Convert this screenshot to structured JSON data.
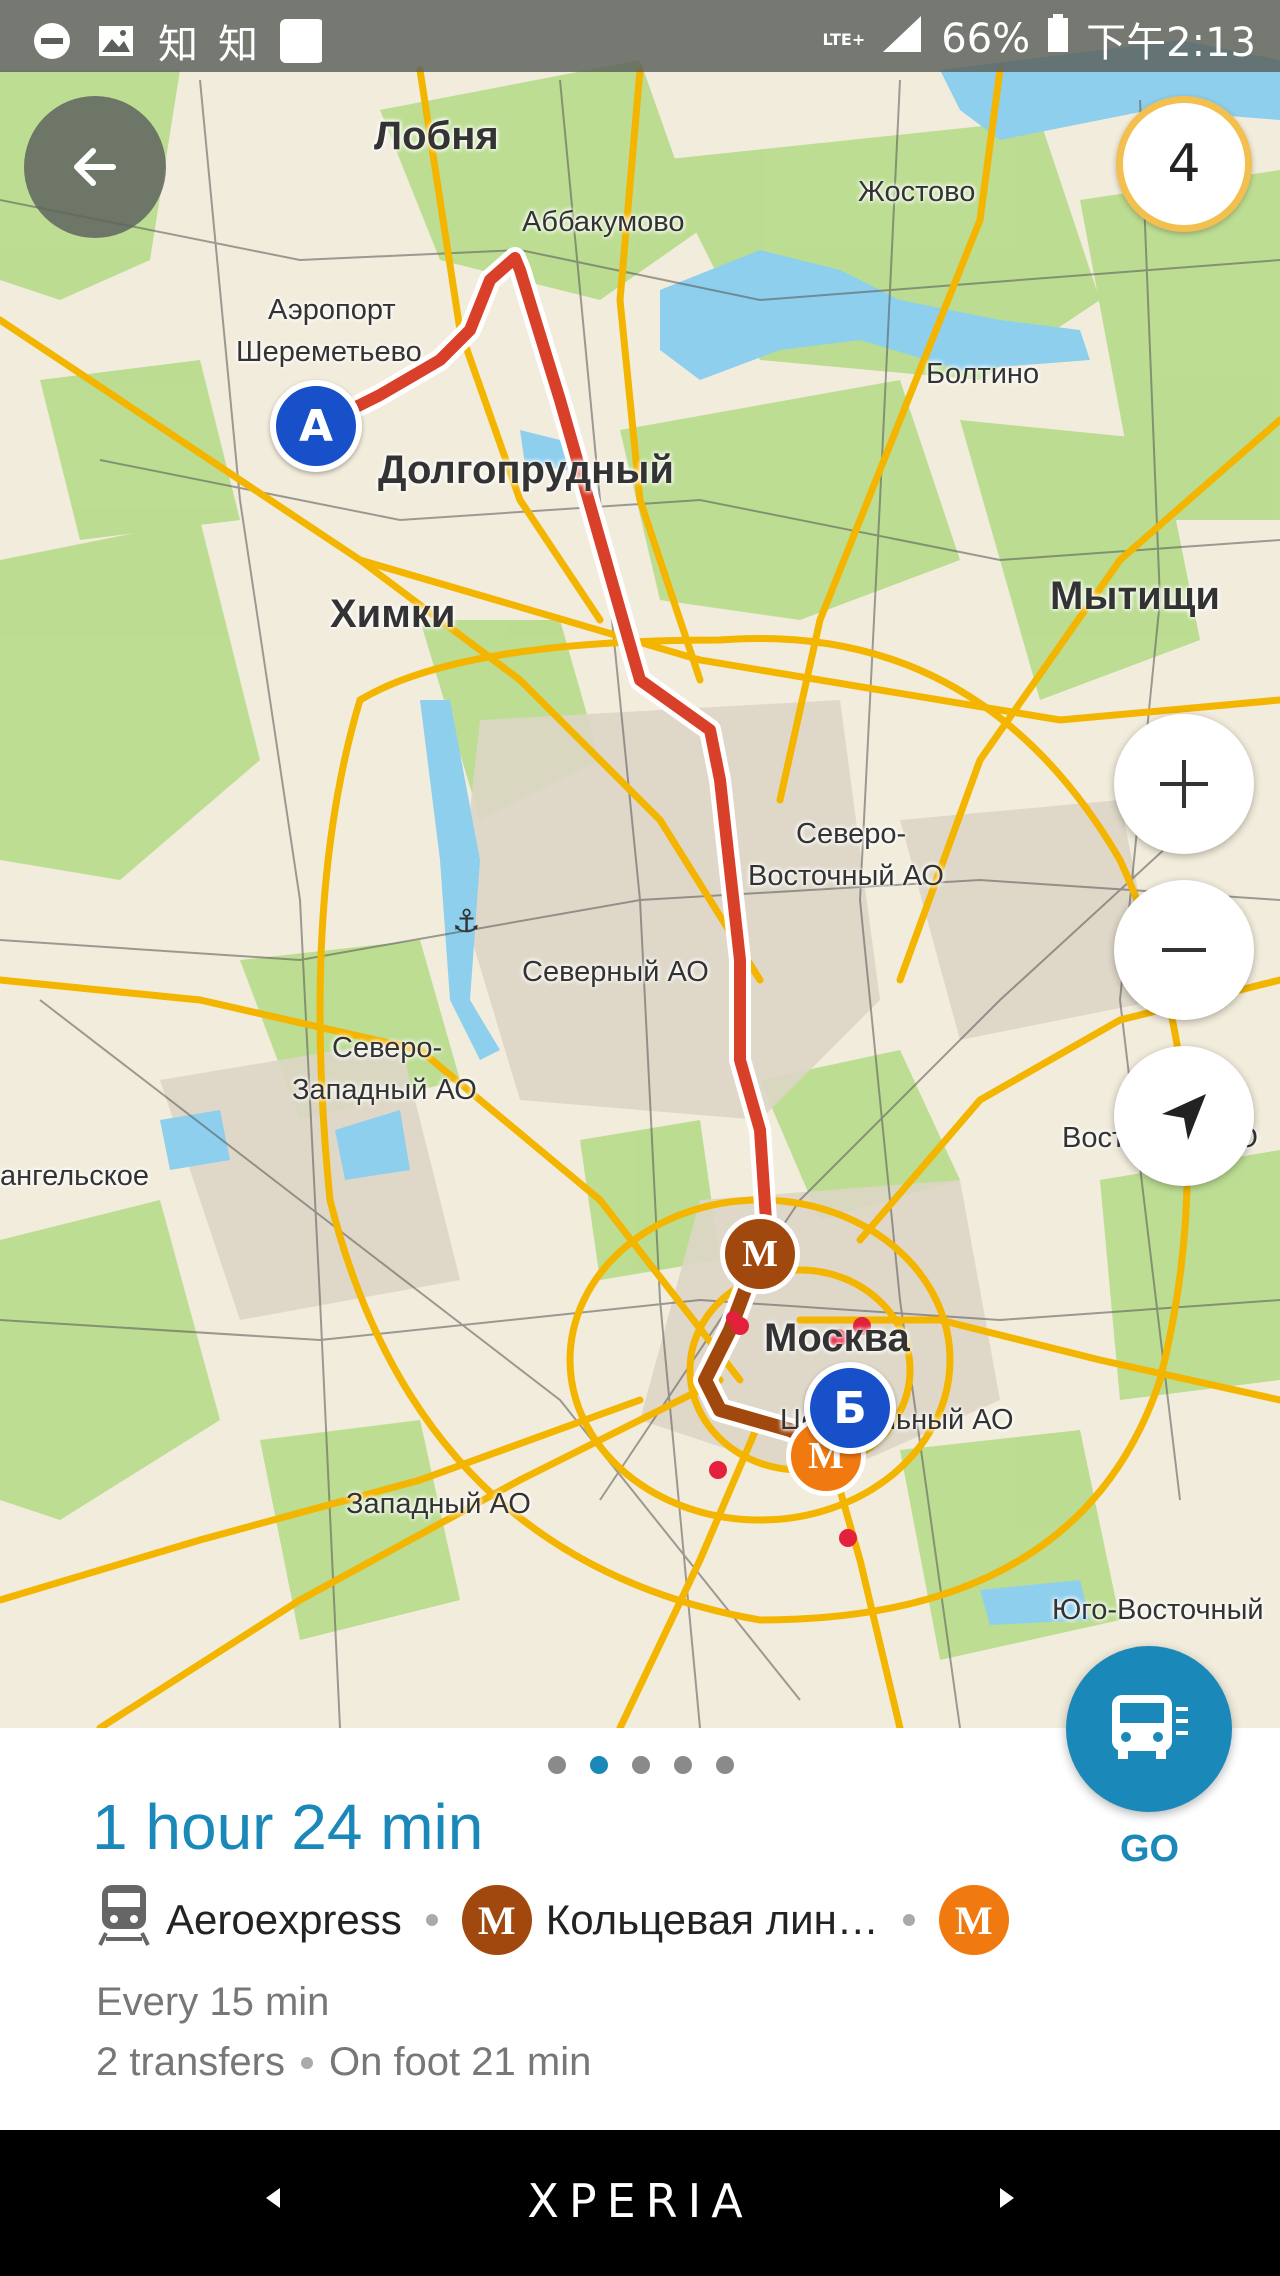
{
  "status_bar": {
    "left_icons": [
      "minus-circle-icon",
      "image-icon"
    ],
    "app_text_1": "知",
    "app_text_2": "知",
    "network": "LTE+",
    "battery": "66%",
    "time": "下午2:13"
  },
  "map": {
    "labels": {
      "lobnya": "Лобня",
      "abbakumovo": "Аббакумово",
      "zhostovo": "Жостово",
      "airport": "Аэропорт",
      "sheremetyevo": "Шереметьево",
      "boltino": "Болтино",
      "dolgoprudny": "Долгопрудный",
      "khimki": "Химки",
      "mytishchi": "Мытищи",
      "severo": "Северо-",
      "vostochny_ao": "Восточный АО",
      "severny_ao": "Северный АО",
      "severo2": "Северо-",
      "zapadny_ao": "Западный АО",
      "arkhangelskoe": "ангельское",
      "vostochny_ao2": "Восточный АО",
      "moskva": "Москва",
      "central_ao": "Центральный АО",
      "zapadny_ao2": "Западный АО",
      "yugo_vostochny": "Юго-Восточный"
    },
    "marker_start": "А",
    "marker_end": "Б",
    "metro_symbol": "М",
    "badge_count": "4",
    "route_color": "#d9402a",
    "metro_line_color": "#a0480e",
    "metro_orange": "#f07a10"
  },
  "route_card": {
    "duration": "1 hour 24 min",
    "go_label": "GO",
    "page_count": 5,
    "active_page": 2,
    "segments": {
      "train": "Aeroexpress",
      "line": "Кольцевая лин…"
    },
    "frequency": "Every 15 min",
    "transfers": "2 transfers",
    "on_foot": "On foot 21 min"
  },
  "nav_bar": {
    "brand": "XPERIA"
  }
}
